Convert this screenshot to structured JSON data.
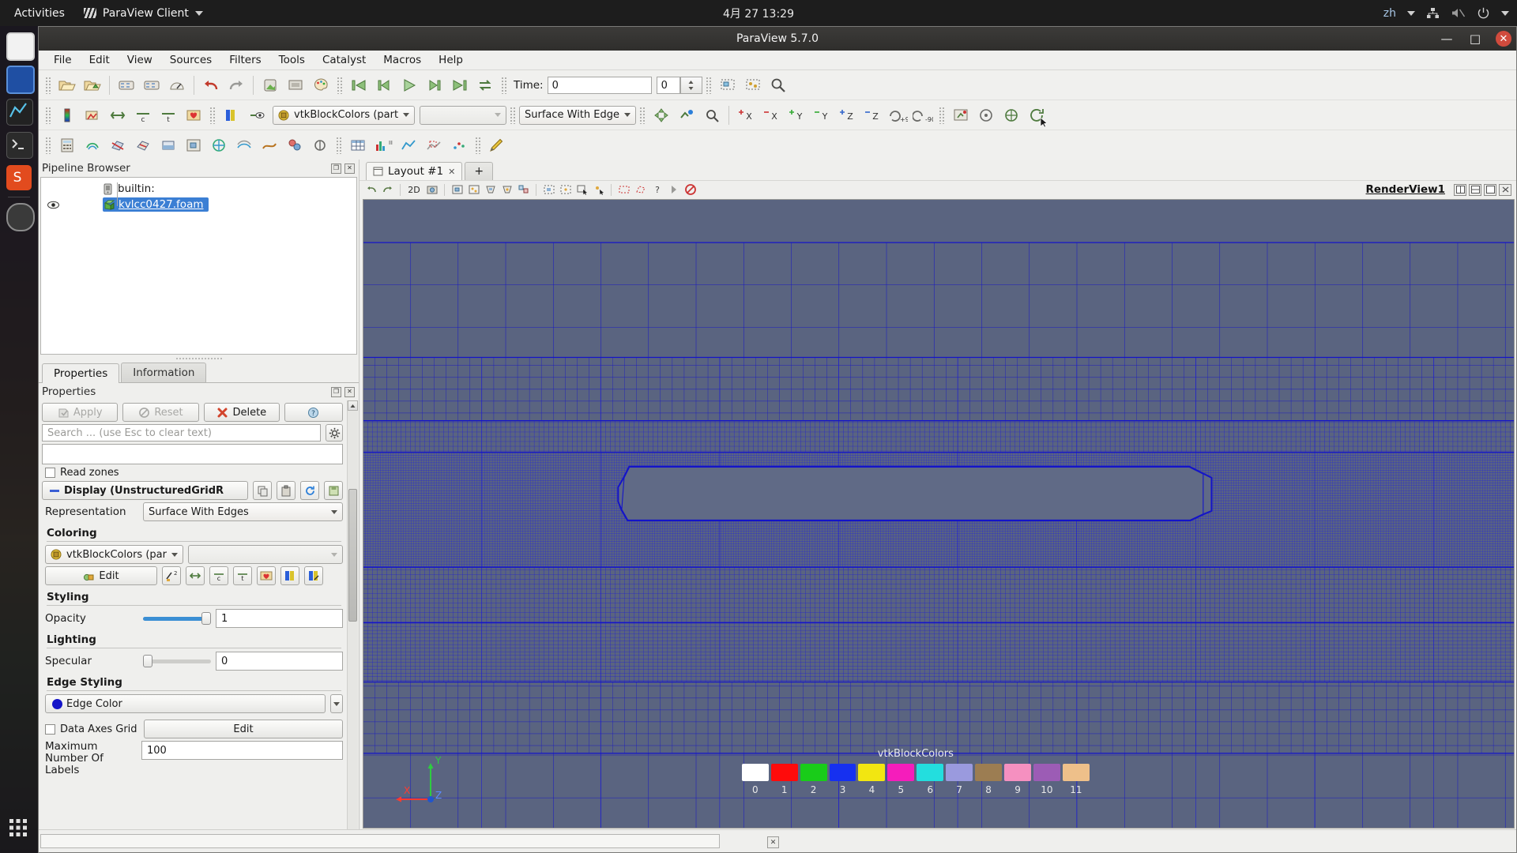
{
  "gnome": {
    "activities": "Activities",
    "app_name": "ParaView Client",
    "clock": "4月 27  13:29",
    "language": "zh",
    "icons": [
      "network-icon",
      "volume-muted-icon",
      "power-icon",
      "chevron-down-icon"
    ]
  },
  "window": {
    "title": "ParaView 5.7.0",
    "minimize": "—",
    "maximize": "□",
    "close": "✕"
  },
  "menubar": {
    "items": [
      "File",
      "Edit",
      "View",
      "Sources",
      "Filters",
      "Tools",
      "Catalyst",
      "Macros",
      "Help"
    ]
  },
  "toolbar": {
    "time_label": "Time:",
    "time_value": "0",
    "time_index": "0",
    "color_array": "vtkBlockColors (partial)",
    "component_value": "",
    "representation": "Surface With Edge"
  },
  "pipeline": {
    "panel_title": "Pipeline Browser",
    "server": "builtin:",
    "source": "kvlcc0427.foam"
  },
  "properties": {
    "tabs": [
      "Properties",
      "Information"
    ],
    "panel_title": "Properties",
    "apply_label": "Apply",
    "reset_label": "Reset",
    "delete_label": "Delete",
    "help_label": "?",
    "search_placeholder": "Search ... (use Esc to clear text)",
    "mesh_regions_value": "",
    "read_zones_label": "Read zones",
    "display_header": "Display (UnstructuredGridR",
    "representation_label": "Representation",
    "representation_value": "Surface With Edges",
    "coloring_header": "Coloring",
    "coloring_value": "vtkBlockColors (partial)",
    "coloring_component": "",
    "edit_label": "Edit",
    "styling_header": "Styling",
    "opacity_label": "Opacity",
    "opacity_value": "1",
    "lighting_header": "Lighting",
    "specular_label": "Specular",
    "specular_value": "0",
    "edge_styling_header": "Edge Styling",
    "edge_color_label": "Edge Color",
    "data_axes_grid_label": "Data Axes Grid",
    "data_axes_edit_label": "Edit",
    "max_labels_label": "Maximum Number Of Labels",
    "max_labels_value": "100"
  },
  "layout": {
    "tab_label": "Layout #1",
    "tab_close": "✕",
    "new_tab": "+",
    "view_name": "RenderView1",
    "mode_2d": "2D"
  },
  "legend": {
    "title": "vtkBlockColors",
    "ticks": [
      "0",
      "1",
      "2",
      "3",
      "4",
      "5",
      "6",
      "7",
      "8",
      "9",
      "10",
      "11"
    ],
    "colors": [
      "#ffffff",
      "#ff0b0b",
      "#19cc19",
      "#1630f0",
      "#f2e611",
      "#f51dbb",
      "#23dede",
      "#9a9ade",
      "#9c7d52",
      "#f590c0",
      "#9c5cb5",
      "#eec08a"
    ]
  },
  "axes": {
    "x_label": "X",
    "y_label": "Y",
    "z_label": "Z"
  },
  "colors": {
    "background_top": "#5a6480",
    "mesh_edge": "#1414c8",
    "hull_fill": "#606a86",
    "selection_blue": "#3b7fd4"
  }
}
